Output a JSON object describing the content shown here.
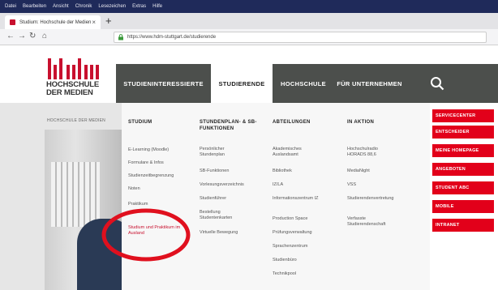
{
  "browser": {
    "menu": [
      "Datei",
      "Bearbeiten",
      "Ansicht",
      "Chronik",
      "Lesezeichen",
      "Extras",
      "Hilfe"
    ],
    "tab_title": "Studium: Hochschule der Medien",
    "url": "https://www.hdm-stuttgart.de/studierende"
  },
  "site": {
    "logo_text": [
      "HOCHSCHULE",
      "DER MEDIEN"
    ],
    "nav": [
      {
        "label": "STUDIENINTERESSIERTE"
      },
      {
        "label": "STUDIERENDE"
      },
      {
        "label": "HOCHSCHULE"
      },
      {
        "label": "FÜR UNTERNEHMEN"
      }
    ],
    "breadcrumb": "HOCHSCHULE DER MEDIEN",
    "mega": {
      "columns": [
        {
          "heading": "STUDIUM",
          "links": [
            "E-Learning (Moodle)",
            "Formulare & Infos",
            "Studienzeitbegrenzung",
            "Noten",
            "Praktikum",
            "Studium und Praktikum im Ausland"
          ]
        },
        {
          "heading": "STUNDENPLAN- & SB-FUNKTIONEN",
          "links": [
            "Persönlicher Stundenplan",
            "SB-Funktionen",
            "Vorlesungsverzeichnis",
            "Studienführer",
            "Bestellung Studentenkarten",
            "Virtuelle Bewegung"
          ]
        },
        {
          "heading": "ABTEILUNGEN",
          "links": [
            "Akademisches Auslandsamt",
            "Bibliothek",
            "IZ/LA",
            "Informationszentrum IZ",
            "Production Space",
            "Prüfungsverwaltung",
            "Sprachenzentrum",
            "Studienbüro",
            "Technikpool"
          ]
        },
        {
          "heading": "IN AKTION",
          "links": [
            "Hochschulradio HORADS 88,6",
            "MediaNight",
            "VSS",
            "Studierendenvertretung",
            "Verfasste Studierendenschaft"
          ]
        }
      ]
    },
    "quicklinks": [
      "SERVICECENTER",
      "ENTSCHEIDER",
      "MEINE HOMEPAGE",
      "ANGEBOTEN",
      "STUDENT ABC",
      "MOBILE",
      "INTRANET"
    ]
  },
  "colors": {
    "accent": "#e2001a",
    "nav_bg": "#4c4f4c",
    "browser_bar": "#1f2a5a"
  },
  "icons": {
    "search": "search-icon"
  }
}
